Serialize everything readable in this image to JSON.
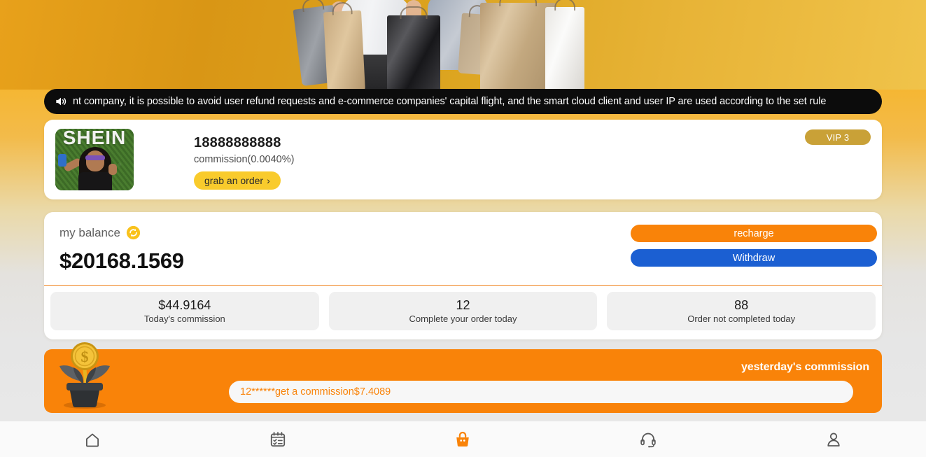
{
  "hero": {
    "alt": "shoppers-carrying-shopping-bags-banner"
  },
  "notice": {
    "icon": "speaker-icon",
    "text": "nt company, it is possible to avoid user refund requests and e-commerce companies' capital flight, and the smart cloud client and user IP are used according to the set rule"
  },
  "profile": {
    "avatar_brand": "SHEIN",
    "phone": "18888888888",
    "commission_label": "commission(0.0040%)",
    "grab_order_label": "grab an order",
    "grab_order_chevron": "›",
    "vip_label": "VIP 3",
    "vip_color": "#c9a137"
  },
  "balance": {
    "label": "my balance",
    "refresh_icon": "refresh-icon",
    "amount": "$20168.1569",
    "recharge_label": "recharge",
    "recharge_color": "#f98309",
    "withdraw_label": "Withdraw",
    "withdraw_color": "#1b5fd2",
    "divider_color": "#ef7f17",
    "stats": [
      {
        "value": "$44.9164",
        "caption": "Today's commission"
      },
      {
        "value": "12",
        "caption": "Complete your order today"
      },
      {
        "value": "88",
        "caption": "Order not completed today"
      }
    ]
  },
  "yesterday": {
    "title": "yesterday's commission",
    "banner_color": "#f98309",
    "icon": "coin-plant-icon",
    "entry": "12******get a commission$7.4089",
    "entry_color": "#f98309"
  },
  "bottom_nav": {
    "active_color": "#f98309",
    "inactive_color": "#5a5a5a",
    "items": [
      {
        "icon": "home-icon",
        "active": false
      },
      {
        "icon": "calendar-checklist-icon",
        "active": false
      },
      {
        "icon": "shopping-bag-icon",
        "active": true
      },
      {
        "icon": "headset-support-icon",
        "active": false
      },
      {
        "icon": "person-profile-icon",
        "active": false
      }
    ]
  }
}
